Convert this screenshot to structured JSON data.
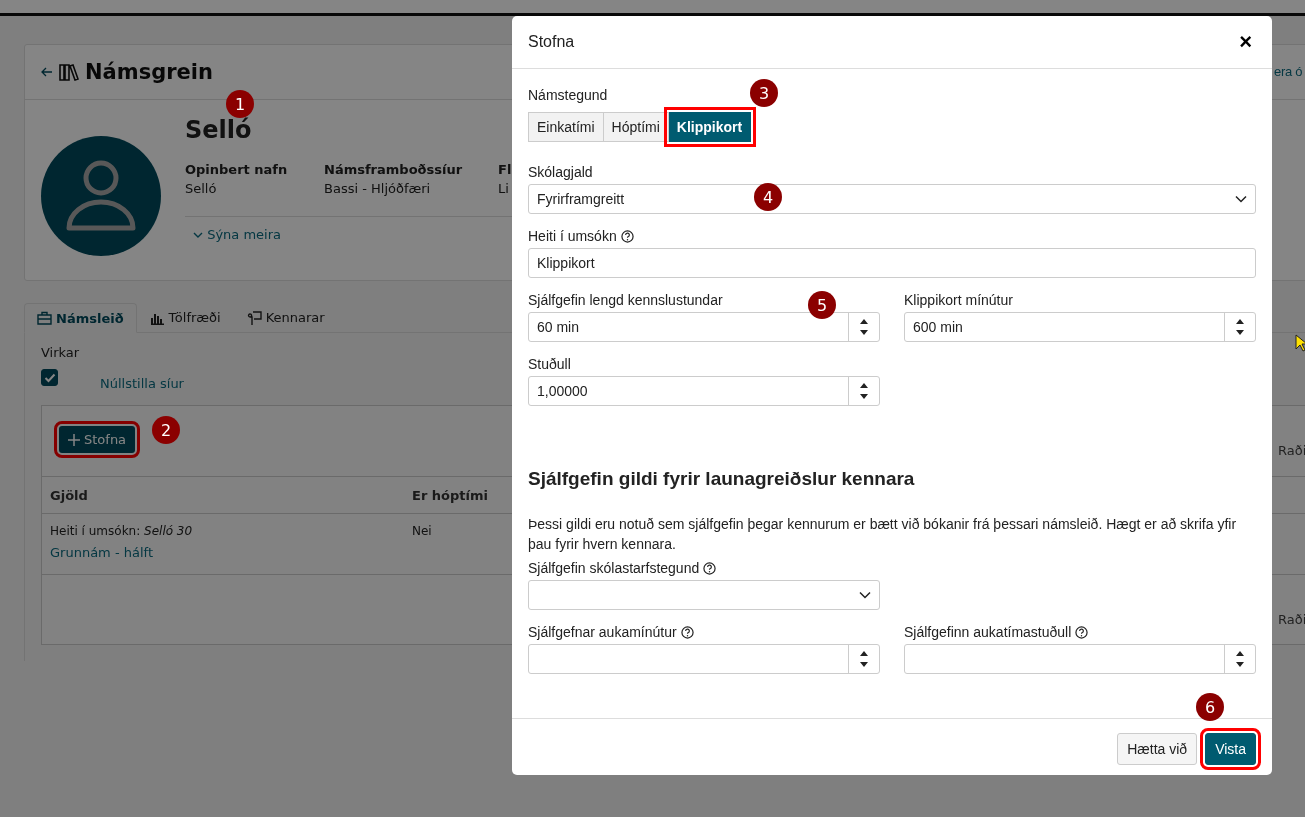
{
  "page": {
    "title": "Námsgrein",
    "subject": "Selló",
    "facts": [
      {
        "label": "Opinbert nafn",
        "value": "Selló"
      },
      {
        "label": "Námsframboðssíur",
        "value": "Bassi - Hljóðfæri"
      },
      {
        "label": "Fl",
        "value": "Li"
      }
    ],
    "show_more": "Sýna meira",
    "tabs": [
      {
        "label": "Námsleið",
        "selected": true
      },
      {
        "label": "Tölfræði",
        "selected": false
      },
      {
        "label": "Kennarar",
        "selected": false
      }
    ],
    "filter": {
      "label": "Virkar",
      "checked": true,
      "reset": "Núllstilla síur"
    },
    "create_button": {
      "label": "Stofna",
      "highlighted": true
    },
    "table": {
      "columns": [
        "Gjöld",
        "Er hóptími"
      ],
      "rows": [
        {
          "application_name": "Heiti í umsókn: *Selló 30*",
          "link": "Grunnám - hálft",
          "group": "Nei"
        }
      ]
    },
    "edge_texts": [
      "era ó",
      "Raði",
      "Raði"
    ]
  },
  "modal": {
    "title": "Stofna",
    "close": "×",
    "type_label": "Námstegund",
    "type_options": [
      {
        "label": "Einkatími",
        "selected": false,
        "highlighted": false
      },
      {
        "label": "Hóptími",
        "selected": false,
        "highlighted": false
      },
      {
        "label": "Klippikort",
        "selected": true,
        "highlighted": true
      }
    ],
    "wide_fields": [
      {
        "kind": "select",
        "label": "Skólagjald",
        "help": false,
        "value": "Fyrirframgreitt"
      },
      {
        "kind": "text",
        "label": "Heiti í umsókn",
        "help": true,
        "value": "Klippikort"
      }
    ],
    "rows": [
      [
        {
          "kind": "number",
          "label": "Sjálfgefin lengd kennslustundar",
          "help": false,
          "value": "60 min"
        },
        {
          "kind": "number",
          "label": "Klippikort mínútur",
          "help": false,
          "value": "600 min"
        }
      ],
      [
        {
          "kind": "number",
          "label": "Stuðull",
          "help": false,
          "value": "1,00000"
        }
      ]
    ],
    "section_title": "Sjálfgefin gildi fyrir launagreiðslur kennara",
    "section_text": "Þessi gildi eru notuð sem sjálfgefin þegar kennurum er bætt við bókanir frá þessari námsleið. Hægt er að skrifa yfir þau fyrir hvern kennara.",
    "section_rows": [
      [
        {
          "kind": "select",
          "label": "Sjálfgefin skólastarfstegund",
          "help": true
        }
      ],
      [
        {
          "kind": "number",
          "label": "Sjálfgefnar aukamínútur",
          "help": true
        },
        {
          "kind": "number",
          "label": "Sjálfgefinn aukatímastuðull",
          "help": true
        }
      ]
    ],
    "cancel": {
      "label": "Hætta við",
      "highlighted": false
    },
    "save": {
      "label": "Vista",
      "highlighted": true
    }
  },
  "annotations": [
    {
      "label": "1"
    },
    {
      "label": "2"
    },
    {
      "label": "3"
    },
    {
      "label": "4"
    },
    {
      "label": "5"
    },
    {
      "label": "6"
    }
  ]
}
